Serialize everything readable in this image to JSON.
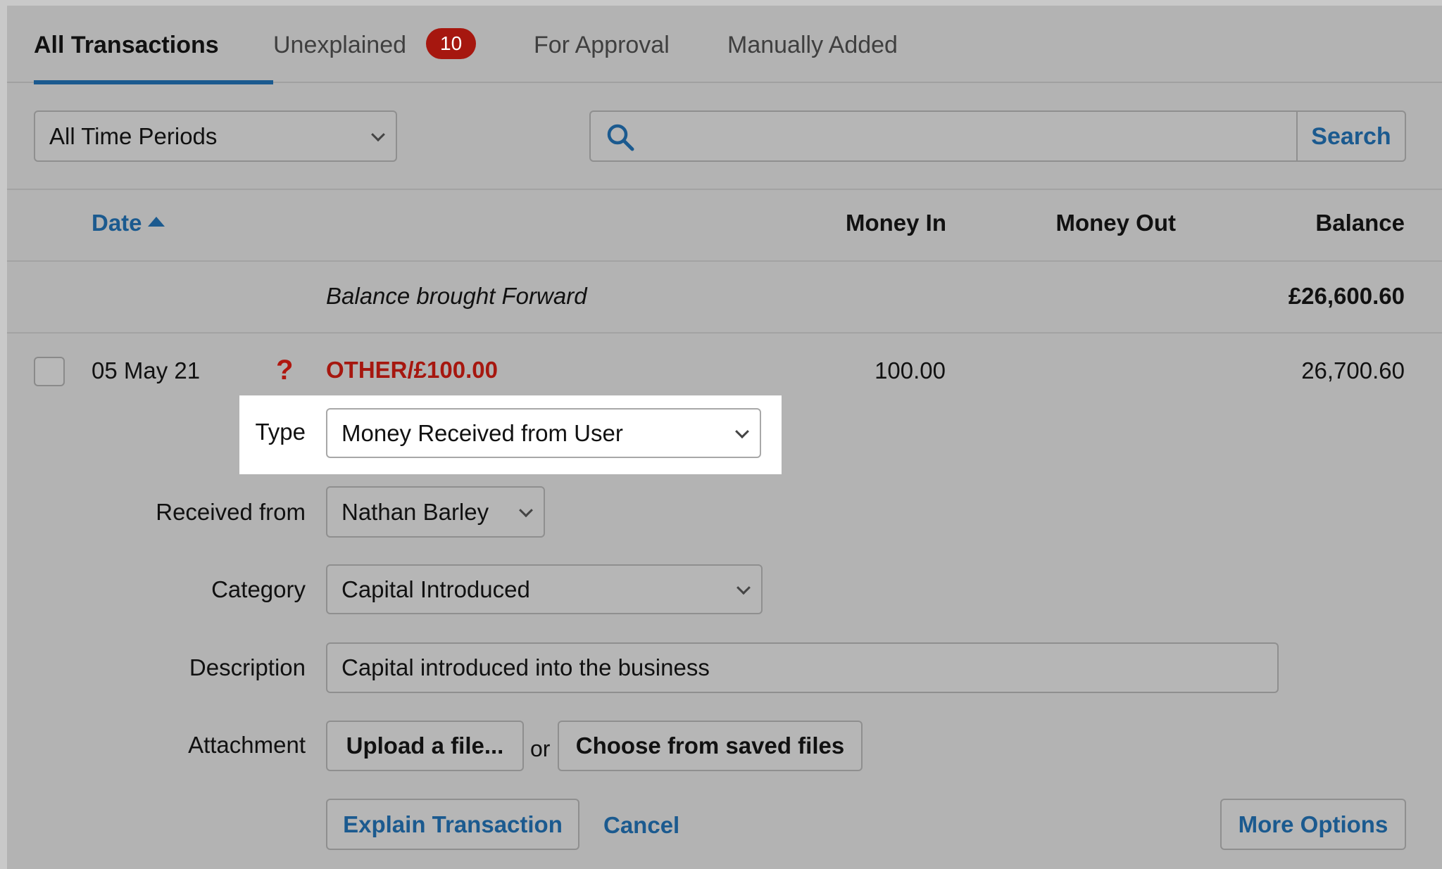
{
  "tabs": [
    {
      "label": "All Transactions",
      "active": true
    },
    {
      "label": "Unexplained",
      "badge": "10"
    },
    {
      "label": "For Approval"
    },
    {
      "label": "Manually Added"
    }
  ],
  "filters": {
    "period_selected": "All Time Periods",
    "search_value": "",
    "search_button": "Search"
  },
  "columns": {
    "date": "Date",
    "money_in": "Money In",
    "money_out": "Money Out",
    "balance": "Balance"
  },
  "balance_forward": {
    "label": "Balance brought Forward",
    "value": "£26,600.60"
  },
  "transaction": {
    "date": "05 May 21",
    "status_mark": "?",
    "description": "OTHER/£100.00",
    "money_in": "100.00",
    "balance": "26,700.60"
  },
  "form": {
    "type_label": "Type",
    "type_value": "Money Received from User",
    "received_from_label": "Received from",
    "received_from_value": "Nathan Barley",
    "category_label": "Category",
    "category_value": "Capital Introduced",
    "description_label": "Description",
    "description_value": "Capital introduced into the business",
    "attachment_label": "Attachment",
    "upload_button": "Upload a file...",
    "or_text": "or",
    "choose_button": "Choose from saved files",
    "explain_button": "Explain Transaction",
    "cancel_link": "Cancel",
    "more_options_button": "More Options"
  },
  "colors": {
    "accent": "#1b5a8f",
    "alert": "#a6170f",
    "overlay_gray": "#b3b3b3"
  }
}
